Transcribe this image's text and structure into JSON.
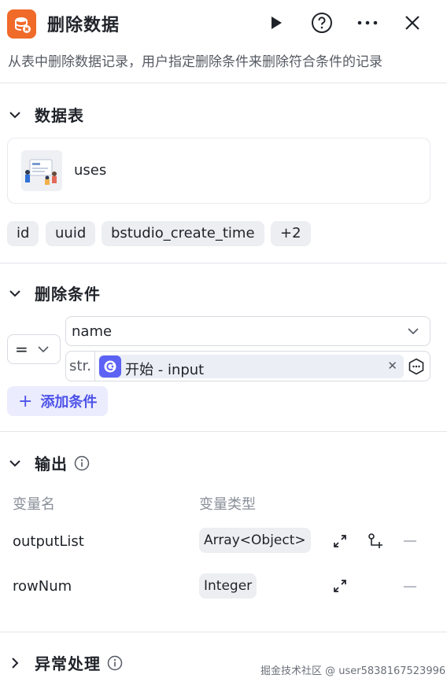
{
  "header": {
    "title": "删除数据",
    "description": "从表中删除数据记录，用户指定删除条件来删除符合条件的记录",
    "icon": "database-delete-icon",
    "actions": [
      "run-icon",
      "help-icon",
      "more-icon",
      "close-icon"
    ]
  },
  "data_table": {
    "section_title": "数据表",
    "table_name": "uses",
    "fields": [
      "id",
      "uuid",
      "bstudio_create_time",
      "+2"
    ]
  },
  "conditions": {
    "section_title": "删除条件",
    "operator": "=",
    "field": "name",
    "value_type": "str.",
    "value_ref": "开始 - input",
    "add_label": "添加条件"
  },
  "output": {
    "section_title": "输出",
    "col_name": "变量名",
    "col_type": "变量类型",
    "rows": [
      {
        "name": "outputList",
        "type": "Array<Object>"
      },
      {
        "name": "rowNum",
        "type": "Integer"
      }
    ]
  },
  "exception": {
    "section_title": "异常处理"
  },
  "watermark": "掘金技术社区 @ user5838167523996",
  "colors": {
    "accent": "#4d53e8",
    "icon_orange": "#f06a2a",
    "ref_purple": "#5c62f4"
  }
}
